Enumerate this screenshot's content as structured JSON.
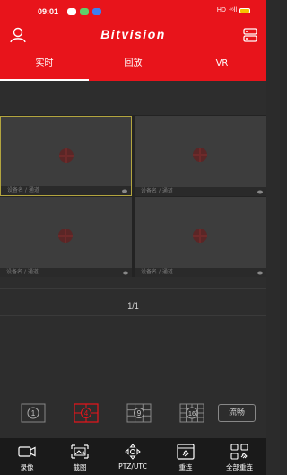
{
  "status_bar": {
    "time": "09:01",
    "network": "HD",
    "signal": "⁴⁶ll"
  },
  "header": {
    "app_title": "Bitvision"
  },
  "tabs": [
    {
      "label": "实时",
      "active": true
    },
    {
      "label": "回放",
      "active": false
    },
    {
      "label": "VR",
      "active": false
    }
  ],
  "video_cells": [
    {
      "caption": "设备名 / 通道",
      "selected": true
    },
    {
      "caption": "设备名 / 通道",
      "selected": false
    },
    {
      "caption": "设备名 / 通道",
      "selected": false
    },
    {
      "caption": "设备名 / 通道",
      "selected": false
    }
  ],
  "pager": {
    "text": "1/1"
  },
  "split_options": [
    {
      "label": "1",
      "active": false
    },
    {
      "label": "4",
      "active": true
    },
    {
      "label": "9",
      "active": false
    },
    {
      "label": "16",
      "active": false
    }
  ],
  "stream_quality": "流畅",
  "toolbar": {
    "record": "录像",
    "snapshot": "截图",
    "ptz": "PTZ/UTC",
    "reconnect": "重连",
    "reconnect_all": "全部重连"
  },
  "colors": {
    "brand": "#e8141b",
    "background": "#2d2d2d",
    "selected_border": "#b3a53f"
  },
  "icons": [
    "user-icon",
    "device-list-icon",
    "record-icon",
    "snapshot-icon",
    "ptz-icon",
    "reconnect-icon",
    "reconnect-all-icon",
    "eye-icon"
  ]
}
